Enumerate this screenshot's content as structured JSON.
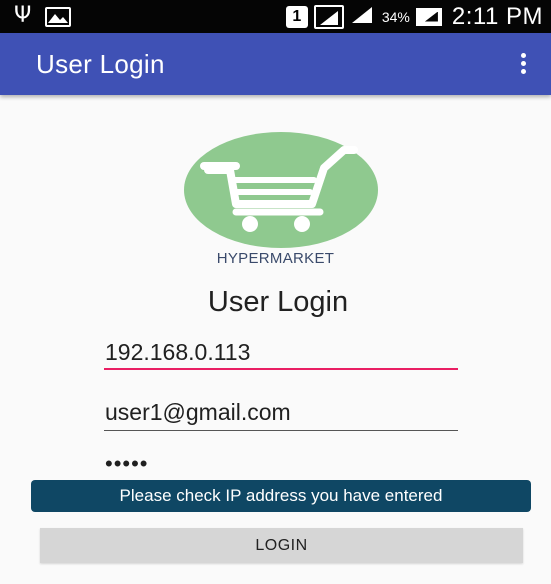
{
  "status_bar": {
    "sim_label": "1",
    "battery_percent": "34%",
    "time": "2:11 PM",
    "icons": [
      "usb-icon",
      "gallery-icon",
      "sim-icon",
      "signal-icon",
      "battery-icon"
    ]
  },
  "app_bar": {
    "title": "User Login",
    "menu_icon": "overflow-menu-icon",
    "color": "#3f51b5"
  },
  "logo": {
    "icon": "shopping-cart-icon",
    "brand": "HYPERMARKET",
    "circle_color": "#8fc98f"
  },
  "form": {
    "heading": "User Login",
    "ip_value": "192.168.0.113",
    "email_value": "user1@gmail.com",
    "password_mask": "•••••",
    "focus_color": "#e91e63"
  },
  "toast": {
    "message": "Please check IP address you have entered"
  },
  "login_button": {
    "label": "LOGIN"
  }
}
